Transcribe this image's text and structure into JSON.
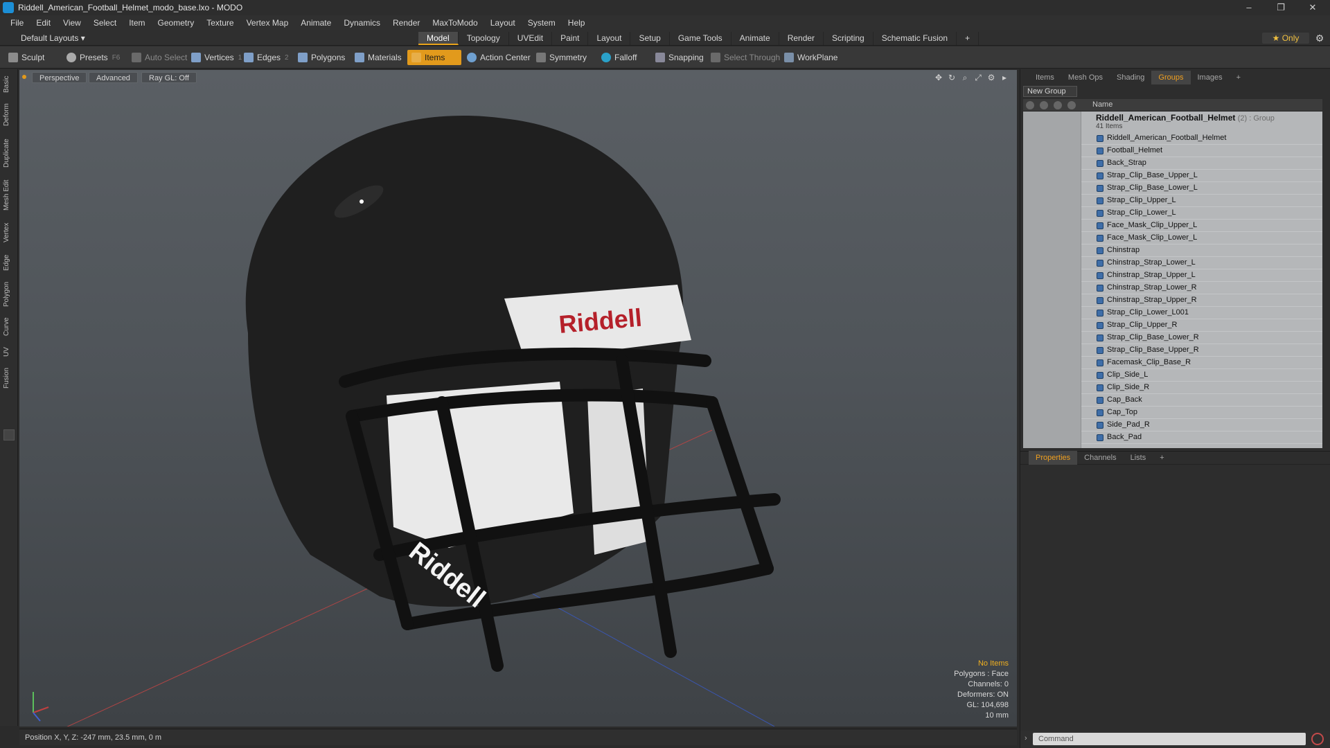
{
  "window": {
    "title": "Riddell_American_Football_Helmet_modo_base.lxo - MODO",
    "min": "–",
    "max": "❐",
    "close": "✕"
  },
  "menu": [
    "File",
    "Edit",
    "View",
    "Select",
    "Item",
    "Geometry",
    "Texture",
    "Vertex Map",
    "Animate",
    "Dynamics",
    "Render",
    "MaxToModo",
    "Layout",
    "System",
    "Help"
  ],
  "layout": {
    "label": "Default Layouts ▾"
  },
  "tabs": [
    "Model",
    "Topology",
    "UVEdit",
    "Paint",
    "Layout",
    "Setup",
    "Game Tools",
    "Animate",
    "Render",
    "Scripting",
    "Schematic Fusion",
    "+"
  ],
  "tabs_active": "Model",
  "only": "★ Only",
  "toolbar": {
    "sculpt": "Sculpt",
    "presets": "Presets",
    "presets_key": "F6",
    "auto_select": "Auto Select",
    "vertices": "Vertices",
    "vertices_key": "1",
    "edges": "Edges",
    "edges_key": "2",
    "polygons": "Polygons",
    "materials": "Materials",
    "items": "Items",
    "action_center": "Action Center",
    "symmetry": "Symmetry",
    "falloff": "Falloff",
    "snapping": "Snapping",
    "select_through": "Select Through",
    "workplane": "WorkPlane"
  },
  "left_tabs": [
    "Basic",
    "Deform",
    "Duplicate",
    "Mesh Edit",
    "Vertex",
    "Edge",
    "Polygon",
    "Curve",
    "UV",
    "Fusion"
  ],
  "viewport": {
    "view": "Perspective",
    "shading": "Advanced",
    "raygl": "Ray GL: Off",
    "logo_top": "Riddell",
    "logo_side": "Riddell"
  },
  "stats": {
    "line1": "No Items",
    "line2": "Polygons : Face",
    "line3": "Channels: 0",
    "line4": "Deformers: ON",
    "line5": "GL: 104,698",
    "line6": "10 mm"
  },
  "status": "Position X, Y, Z:  -247 mm, 23.5 mm, 0 m",
  "right_tabs": [
    "Items",
    "Mesh Ops",
    "Shading",
    "Groups",
    "Images",
    "+"
  ],
  "right_tabs_active": "Groups",
  "new_group": "New Group",
  "list_header": "Name",
  "group": {
    "name": "Riddell_American_Football_Helmet",
    "tag": "(2) : Group",
    "count": "41 Items"
  },
  "items": [
    "Riddell_American_Football_Helmet",
    "Football_Helmet",
    "Back_Strap",
    "Strap_Clip_Base_Upper_L",
    "Strap_Clip_Base_Lower_L",
    "Strap_Clip_Upper_L",
    "Strap_Clip_Lower_L",
    "Face_Mask_Clip_Upper_L",
    "Face_Mask_Clip_Lower_L",
    "Chinstrap",
    "Chinstrap_Strap_Lower_L",
    "Chinstrap_Strap_Upper_L",
    "Chinstrap_Strap_Lower_R",
    "Chinstrap_Strap_Upper_R",
    "Strap_Clip_Lower_L001",
    "Strap_Clip_Upper_R",
    "Strap_Clip_Base_Lower_R",
    "Strap_Clip_Base_Upper_R",
    "Facemask_Clip_Base_R",
    "Clip_Side_L",
    "Clip_Side_R",
    "Cap_Back",
    "Cap_Top",
    "Side_Pad_R",
    "Back_Pad"
  ],
  "props_tabs": [
    "Properties",
    "Channels",
    "Lists",
    "+"
  ],
  "props_active": "Properties",
  "command": "Command",
  "colors": {
    "accent": "#e29a1c",
    "panel": "#2d2d2d",
    "list": "#b5b7b9",
    "helmet": "#1f1f1f"
  }
}
